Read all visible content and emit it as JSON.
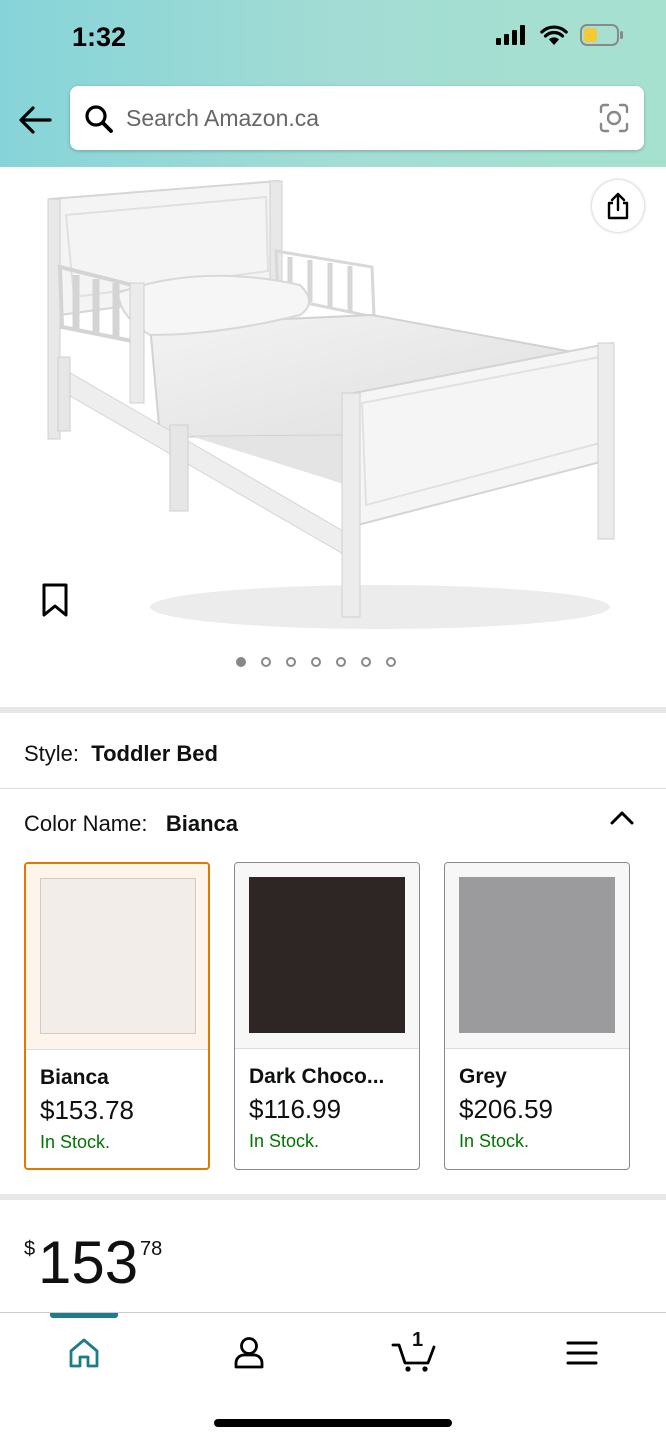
{
  "status_bar": {
    "time": "1:32"
  },
  "search": {
    "placeholder": "Search Amazon.ca"
  },
  "gallery": {
    "image_count": 7,
    "active_index": 0
  },
  "style_row": {
    "label": "Style:",
    "value": "Toddler Bed"
  },
  "color_row": {
    "label": "Color Name:",
    "value": "Bianca"
  },
  "swatches": [
    {
      "name": "Bianca",
      "price": "$153.78",
      "stock": "In Stock.",
      "color": "#f2ede8",
      "selected": true
    },
    {
      "name": "Dark Choco...",
      "price": "$116.99",
      "stock": "In Stock.",
      "color": "#2e2624",
      "selected": false
    },
    {
      "name": "Grey",
      "price": "$206.59",
      "stock": "In Stock.",
      "color": "#9b9a9c",
      "selected": false
    }
  ],
  "price": {
    "currency": "$",
    "whole": "153",
    "fraction": "78"
  },
  "bottom_nav": {
    "items": [
      "home-icon",
      "account-icon",
      "cart-icon",
      "menu-icon"
    ],
    "cart_count": "1",
    "active": "home-icon"
  },
  "colors": {
    "accent": "#1f7a8c",
    "selected_border": "#e77600",
    "stock_green": "#007600"
  }
}
